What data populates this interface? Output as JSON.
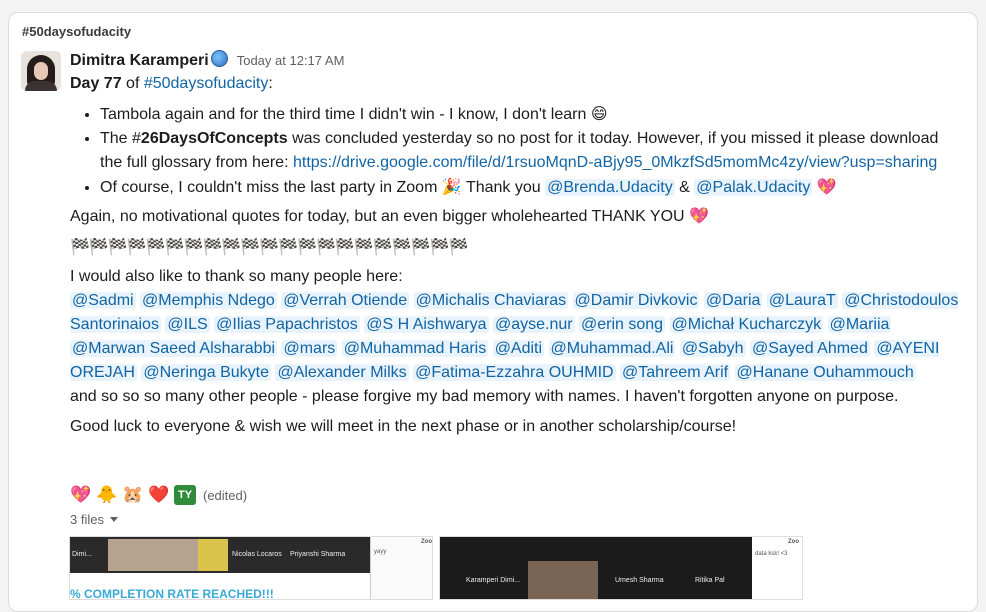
{
  "channel": "#50daysofudacity",
  "author": {
    "name": "Dimitra Karamperi",
    "time": "Today at 12:17 AM"
  },
  "message": {
    "day_prefix": "Day 77",
    "day_of": " of ",
    "day_channel": "#50daysofudacity",
    "day_colon": ":",
    "bullet1": "Tambola again and for the third time I didn't win - I know, I don't learn",
    "bullet1_emoji": "😄",
    "bullet2_pre": "The #",
    "bullet2_bold": "26DaysOfConcepts",
    "bullet2_post": " was concluded yesterday so no post for it today. However, if you missed it please download the full glossary from here: ",
    "bullet2_link": "https://drive.google.com/file/d/1rsuoMqnD-aBjy95_0MkzfSd5momMc4zy/view?usp=sharing",
    "bullet3_pre": "Of course, I couldn't miss the last party in Zoom",
    "bullet3_party": "🎉",
    "bullet3_thank": " Thank you ",
    "bullet3_m1": "@Brenda.Udacity",
    "bullet3_amp": " & ",
    "bullet3_m2": "@Palak.Udacity",
    "heart": "💖",
    "again": "Again, no motivational quotes for today, but an even bigger wholehearted THANK YOU",
    "flags": "🏁🏁🏁🏁🏁🏁🏁🏁🏁🏁🏁🏁🏁🏁🏁🏁🏁🏁🏁🏁🏁",
    "thank_intro": "I would also like to thank so many people here:",
    "mentions": [
      "@Sadmi",
      "@Memphis Ndego",
      "@Verrah Otiende",
      "@Michalis Chaviaras",
      "@Damir Divkovic",
      "@Daria",
      "@LauraT",
      "@Christodoulos Santorinaios",
      "@ILS",
      "@Ilias Papachristos",
      "@S H Aishwarya",
      "@ayse.nur",
      "@erin song",
      "@Michał Kucharczyk",
      "@Mariia",
      "@Marwan Saeed Alsharabbi",
      "@mars",
      "@Muhammad Haris",
      "@Aditi",
      "@Muhammad.Ali",
      "@Sabyh",
      "@Sayed Ahmed",
      "@AYENI OREJAH",
      "@Neringa Bukyte",
      "@Alexander Milks",
      "@Fatima-Ezzahra OUHMID",
      "@Tahreem Arif",
      "@Hanane Ouhammouch"
    ],
    "so_many": "and so so so many other people - please forgive my bad memory with names. I haven't forgotten anyone on purpose.",
    "good_luck": "Good luck to everyone & wish we will meet in the next phase or in another scholarship/course!"
  },
  "reactions": [
    "💖",
    "🐥",
    "🐹",
    "❤️",
    "TY"
  ],
  "edited": "(edited)",
  "files_label": "3 files",
  "thumb1": {
    "tile1": "Dimi...",
    "tile2": "Nicolas Locaros",
    "tile3": "Priyanshi Sharma",
    "banner": "% COMPLETION RATE REACHED!!!",
    "side_title": "Zoo",
    "side_text": "yayy"
  },
  "thumb2": {
    "tile1": "Karamperi Dimi...",
    "tile2": "Umesh Sharma",
    "tile3": "Ritika Pal",
    "side_title": "Zoo",
    "side_text": "data ksk! <3"
  }
}
